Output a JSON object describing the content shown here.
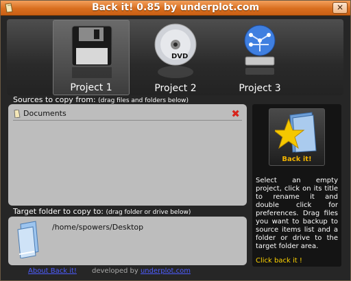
{
  "window": {
    "title": "Back it! 0.85 by underplot.com",
    "close_label": "✕"
  },
  "projects": [
    {
      "label": "Project 1",
      "icon": "floppy-disk-icon",
      "selected": true
    },
    {
      "label": "Project 2",
      "icon": "dvd-icon",
      "selected": false
    },
    {
      "label": "Project 3",
      "icon": "network-drive-icon",
      "selected": false
    }
  ],
  "sources": {
    "label": "Sources to copy from:",
    "hint": "(drag files and folders below)",
    "items": [
      {
        "name": "Documents",
        "remove_icon": "remove-icon"
      }
    ]
  },
  "target": {
    "label": "Target folder to copy to:",
    "hint": "(drag folder or drive below)",
    "path": "/home/spowers/Desktop"
  },
  "side": {
    "button_label": "Back it!",
    "help": "Select an empty project, click on its title to rename it and double click for preferences. Drag files you want to backup to source items list and a folder or drive to the target folder area.",
    "cta": "Click back it !"
  },
  "footer": {
    "about": "About Back it!",
    "developed": "developed by",
    "site": "underplot.com"
  },
  "colors": {
    "titlebar": "#d86e1f",
    "panel": "#bdbdbd",
    "accent": "#f2b400",
    "link": "#4d5cff"
  }
}
